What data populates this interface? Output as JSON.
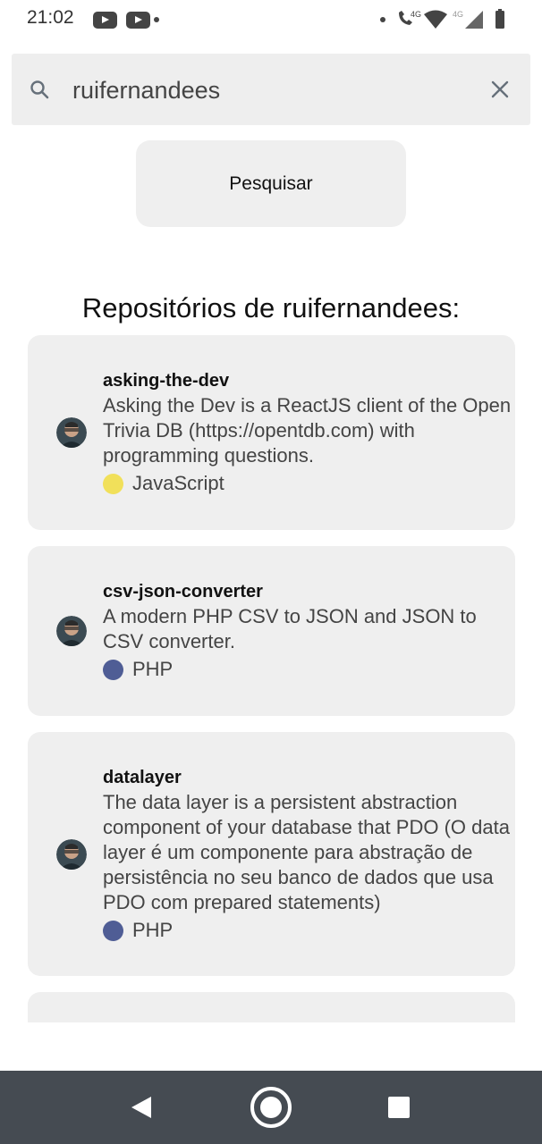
{
  "status_bar": {
    "time": "21:02",
    "network_1": "4G",
    "network_2": "4G"
  },
  "search": {
    "value": "ruifernandees",
    "button_label": "Pesquisar"
  },
  "section_title": "Repositórios de ruifernandees:",
  "repos": [
    {
      "name": "asking-the-dev",
      "description": "Asking the Dev is a ReactJS client of the Open Trivia DB (https://opentdb.com) with programming questions.",
      "language": "JavaScript",
      "language_color": "#f1e05a"
    },
    {
      "name": "csv-json-converter",
      "description": "A modern PHP CSV to JSON and JSON to CSV converter.",
      "language": "PHP",
      "language_color": "#4f5d95"
    },
    {
      "name": "datalayer",
      "description": "The data layer is a persistent abstraction component of your database that PDO (O data layer é um componente para abstração de persistência no seu banco de dados que usa PDO com prepared statements)",
      "language": "PHP",
      "language_color": "#4f5d95"
    }
  ],
  "icons": {
    "search": "search-icon",
    "clear": "close-icon",
    "back": "back-icon",
    "home": "home-icon",
    "recents": "recents-icon"
  },
  "colors": {
    "card_background": "#efefef",
    "nav_bar": "#454b52"
  }
}
